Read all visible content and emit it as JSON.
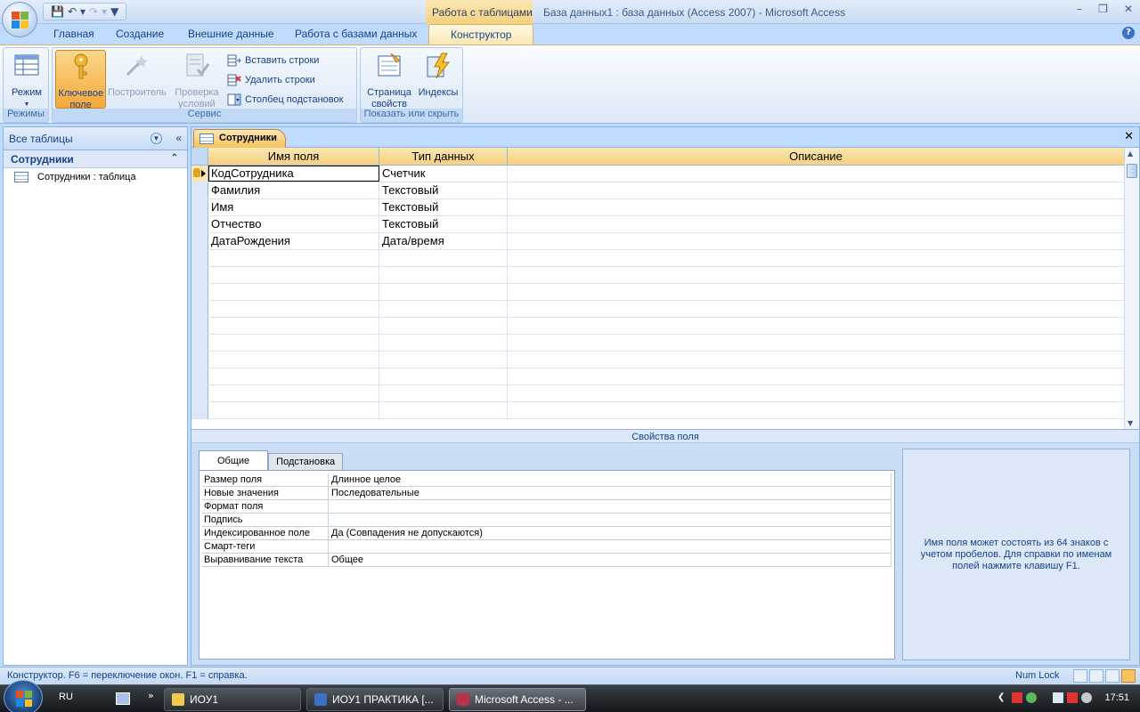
{
  "window": {
    "app_title": "База данных1 : база данных (Access 2007) - Microsoft Access",
    "context_tab_title": "Работа с таблицами"
  },
  "ribbon_tabs": [
    "Главная",
    "Создание",
    "Внешние данные",
    "Работа с базами данных",
    "Конструктор"
  ],
  "ribbon": {
    "groups": {
      "views": "Режимы",
      "tools": "Сервис",
      "show_hide": "Показать или скрыть"
    },
    "buttons": {
      "view": "Режим",
      "primary_key": "Ключевое поле",
      "builder": "Построитель",
      "test_validation": "Проверка условий",
      "insert_rows": "Вставить строки",
      "delete_rows": "Удалить строки",
      "lookup_column": "Столбец  подстановок",
      "property_sheet": "Страница свойств",
      "indexes": "Индексы"
    }
  },
  "nav_pane": {
    "header": "Все таблицы",
    "group": "Сотрудники",
    "items": [
      "Сотрудники : таблица"
    ]
  },
  "document": {
    "tab_label": "Сотрудники",
    "columns": [
      "Имя поля",
      "Тип данных",
      "Описание"
    ],
    "rows": [
      {
        "name": "КодСотрудника",
        "type": "Счетчик",
        "desc": ""
      },
      {
        "name": "Фамилия",
        "type": "Текстовый",
        "desc": ""
      },
      {
        "name": "Имя",
        "type": "Текстовый",
        "desc": ""
      },
      {
        "name": "Отчество",
        "type": "Текстовый",
        "desc": ""
      },
      {
        "name": "ДатаРождения",
        "type": "Дата/время",
        "desc": ""
      }
    ],
    "empty_rows": 10
  },
  "field_properties": {
    "title": "Свойства поля",
    "tabs": [
      "Общие",
      "Подстановка"
    ],
    "rows": [
      {
        "key": "Размер поля",
        "value": "Длинное целое"
      },
      {
        "key": "Новые значения",
        "value": "Последовательные"
      },
      {
        "key": "Формат поля",
        "value": ""
      },
      {
        "key": "Подпись",
        "value": ""
      },
      {
        "key": "Индексированное поле",
        "value": "Да (Совпадения не допускаются)"
      },
      {
        "key": "Смарт-теги",
        "value": ""
      },
      {
        "key": "Выравнивание текста",
        "value": "Общее"
      }
    ],
    "hint": "Имя поля может состоять из 64 знаков с учетом пробелов.  Для справки по именам полей нажмите клавишу F1."
  },
  "status_bar": {
    "text": "Конструктор.  F6 = переключение окон.  F1 = справка.",
    "numlock": "Num Lock"
  },
  "taskbar": {
    "lang": "RU",
    "more": "»",
    "tasks": [
      "ИОУ1",
      "ИОУ1 ПРАКТИКА [...",
      "Microsoft Access - ..."
    ],
    "clock": "17:51"
  },
  "colors": {
    "ribbon_blue": "#bfdbff",
    "accent_orange": "#f6c35c",
    "text_blue": "#15428b"
  }
}
